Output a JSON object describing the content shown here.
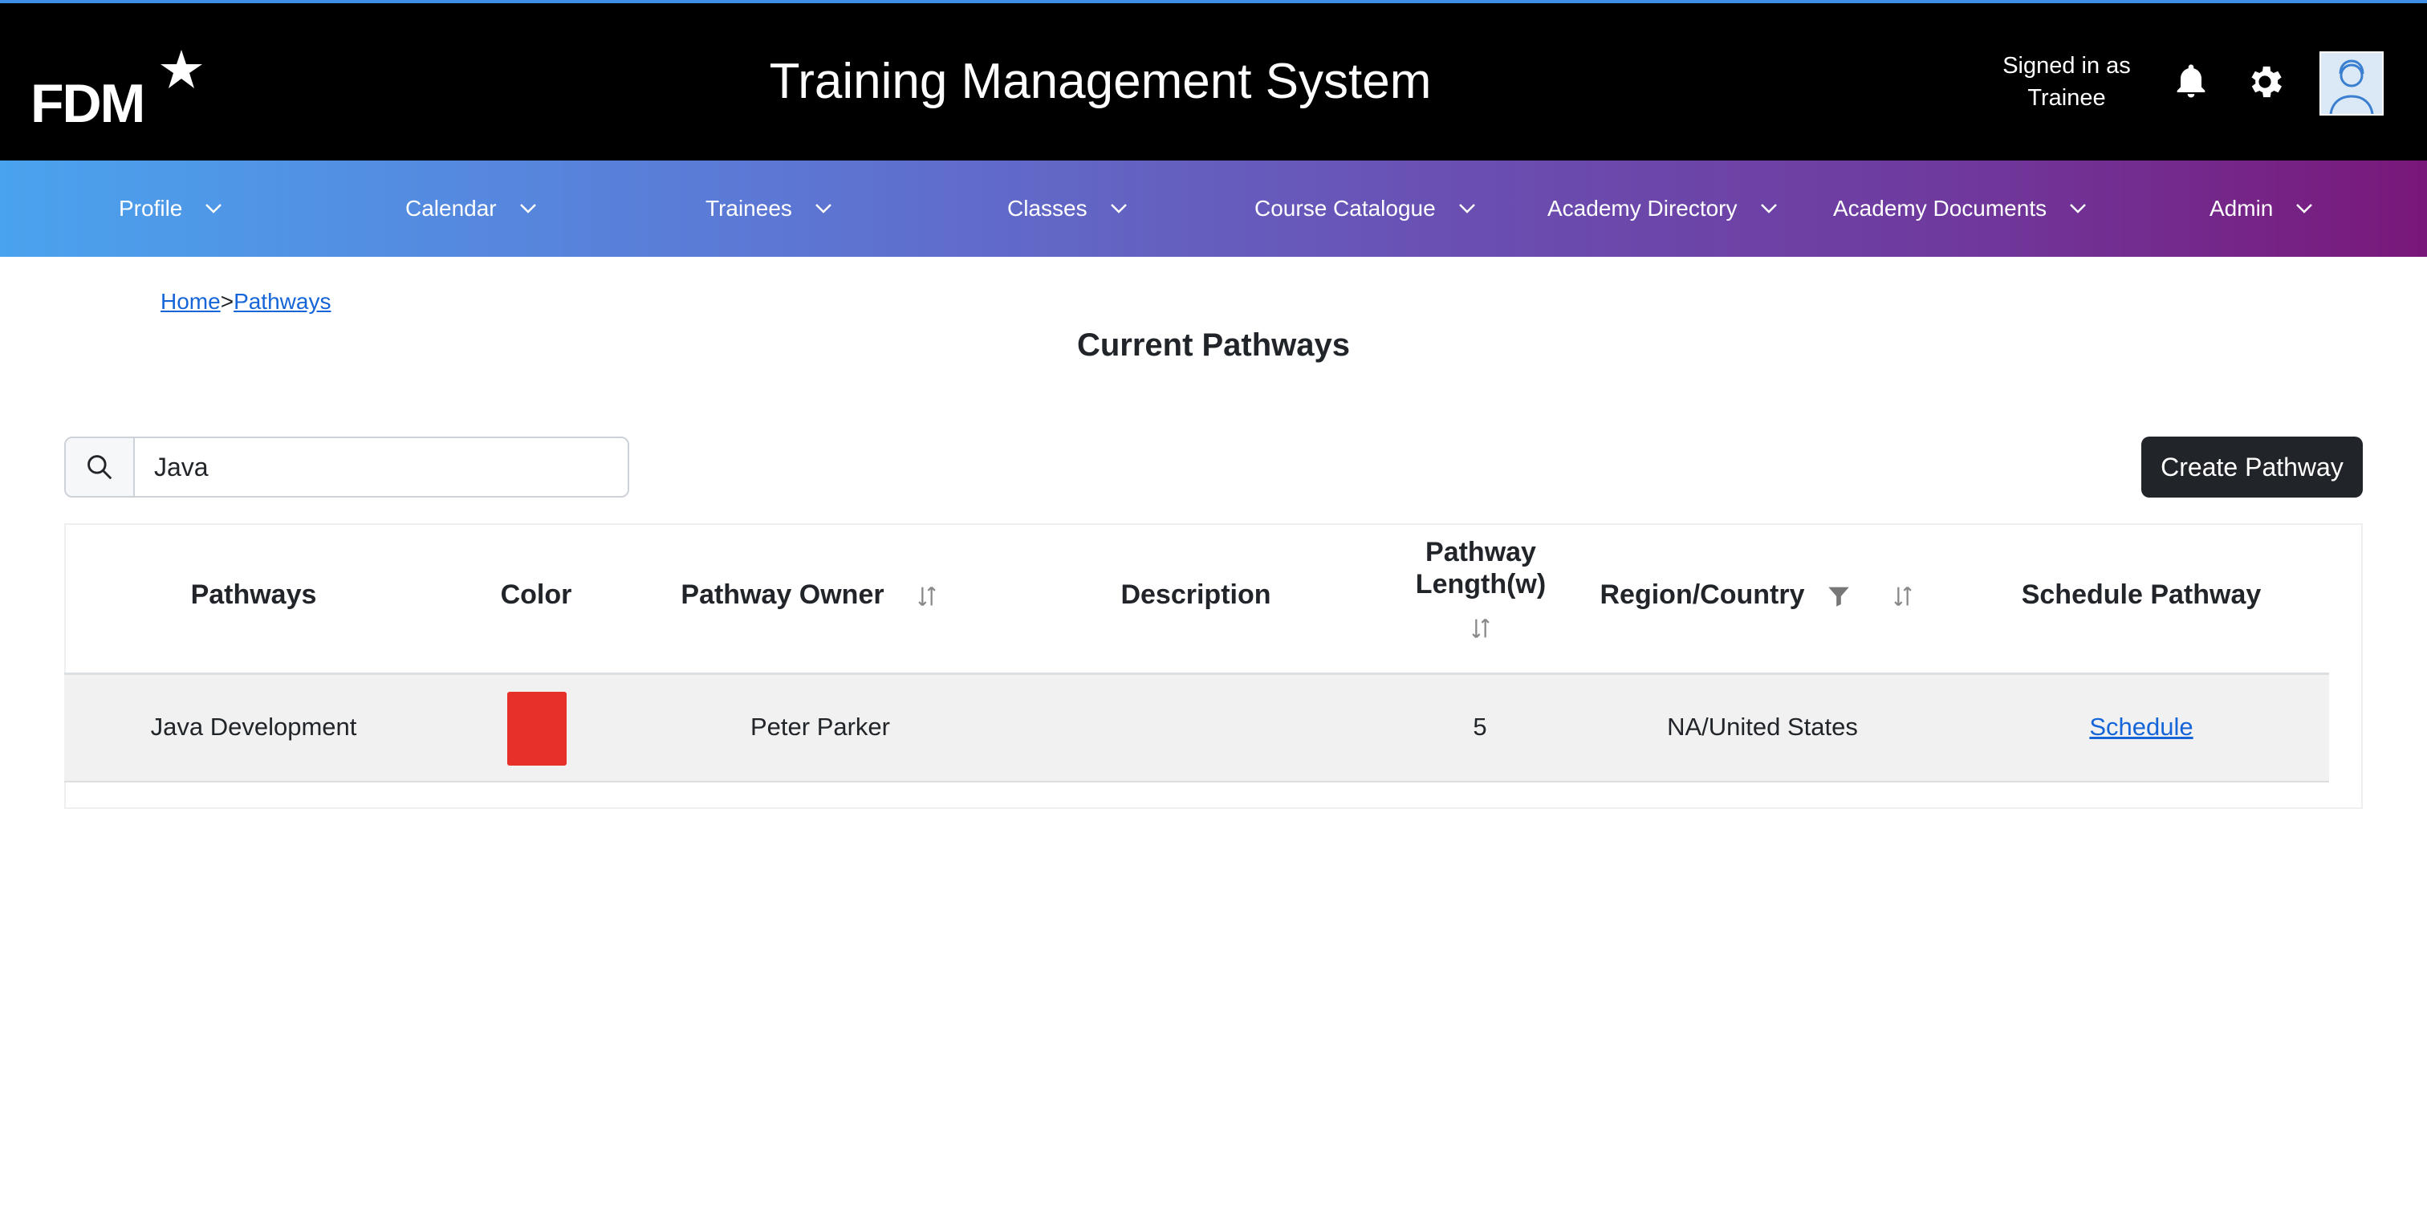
{
  "header": {
    "logo_text": "FDM",
    "app_title": "Training Management System",
    "signed_in_line1": "Signed in as",
    "signed_in_line2": "Trainee",
    "icons": [
      "bell-icon",
      "gear-icon",
      "avatar"
    ]
  },
  "nav": {
    "items": [
      {
        "label": "Profile"
      },
      {
        "label": "Calendar"
      },
      {
        "label": "Trainees"
      },
      {
        "label": "Classes"
      },
      {
        "label": "Course Catalogue"
      },
      {
        "label": "Academy Directory"
      },
      {
        "label": "Academy Documents"
      },
      {
        "label": "Admin"
      }
    ]
  },
  "breadcrumb": {
    "home": "Home",
    "separator": ">",
    "current": "Pathways"
  },
  "page": {
    "title": "Current Pathways"
  },
  "search": {
    "value": "Java",
    "placeholder": ""
  },
  "actions": {
    "create_label": "Create Pathway"
  },
  "table": {
    "headers": {
      "pathways": "Pathways",
      "color": "Color",
      "owner": "Pathway Owner",
      "description": "Description",
      "length_line1": "Pathway",
      "length_line2": "Length(w)",
      "region": "Region/Country",
      "schedule": "Schedule Pathway"
    },
    "rows": [
      {
        "pathway": "Java Development",
        "color": "#e8302a",
        "owner": "Peter Parker",
        "description": "",
        "length": "5",
        "region": "NA/United States",
        "schedule_label": "Schedule"
      }
    ]
  },
  "colors": {
    "header_bg": "#000000",
    "nav_gradient_start": "#4aa3ee",
    "nav_gradient_end": "#79187a",
    "link": "#1565d8",
    "primary_button": "#212529"
  }
}
